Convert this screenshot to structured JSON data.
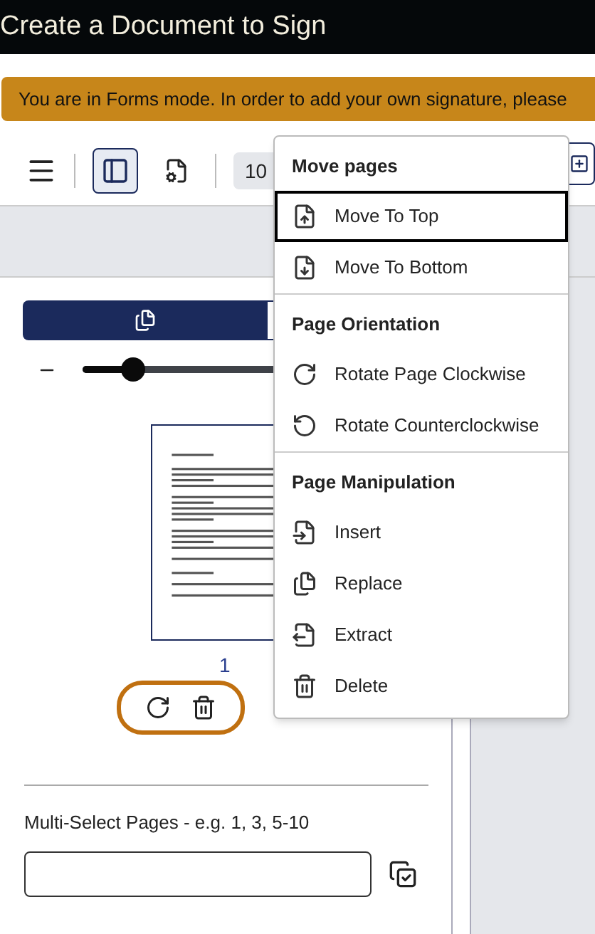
{
  "window": {
    "title": "Create a Document to Sign"
  },
  "banner": {
    "text": "You are in Forms mode. In order to add your own signature, please"
  },
  "toolbar": {
    "zoom": "10",
    "sidebar_toggle": {
      "selected": true
    }
  },
  "panel": {
    "tabs": [
      {
        "selected": true
      },
      {
        "selected": false
      }
    ],
    "zoom_slider": {
      "level": 0.15
    },
    "page": {
      "number": "1"
    },
    "multi_select": {
      "label": "Multi-Select Pages - e.g. 1, 3, 5-10"
    }
  },
  "menu": {
    "sections": [
      {
        "heading": "Move pages",
        "items": [
          {
            "label": "Move To Top",
            "kind": "move_top",
            "selected": true
          },
          {
            "label": "Move To Bottom",
            "kind": "move_bottom",
            "selected": false
          }
        ]
      },
      {
        "heading": "Page Orientation",
        "items": [
          {
            "label": "Rotate Page Clockwise",
            "kind": "rotate_cw",
            "selected": false
          },
          {
            "label": "Rotate Counterclockwise",
            "kind": "rotate_ccw",
            "selected": false
          }
        ]
      },
      {
        "heading": "Page Manipulation",
        "items": [
          {
            "label": "Insert",
            "kind": "insert",
            "selected": false
          },
          {
            "label": "Replace",
            "kind": "replace",
            "selected": false
          },
          {
            "label": "Extract",
            "kind": "extract",
            "selected": false
          },
          {
            "label": "Delete",
            "kind": "delete",
            "selected": false
          }
        ]
      }
    ]
  }
}
